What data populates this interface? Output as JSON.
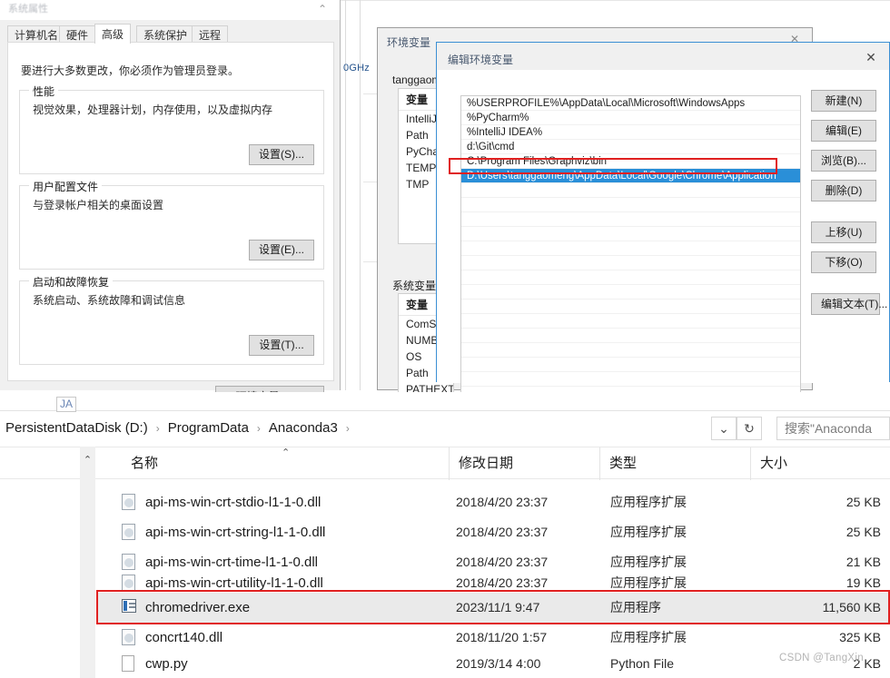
{
  "system_properties": {
    "title": "系统属性",
    "close_icon": "close-icon",
    "tabs": [
      {
        "label": "计算机名",
        "active": false
      },
      {
        "label": "硬件",
        "active": false
      },
      {
        "label": "高级",
        "active": true
      },
      {
        "label": "系统保护",
        "active": false
      },
      {
        "label": "远程",
        "active": false
      }
    ],
    "hint": "要进行大多数更改，你必须作为管理员登录。",
    "groups": [
      {
        "title": "性能",
        "text": "视觉效果，处理器计划，内存使用，以及虚拟内存",
        "button": "设置(S)..."
      },
      {
        "title": "用户配置文件",
        "text": "与登录帐户相关的桌面设置",
        "button": "设置(E)..."
      },
      {
        "title": "启动和故障恢复",
        "text": "系统启动、系统故障和调试信息",
        "button": "设置(T)..."
      }
    ],
    "env_button": "环境变量(N)..."
  },
  "backdrop": {
    "cpu_fragment": "0GHz"
  },
  "env_window": {
    "title": "环境变量",
    "close_icon": "close-icon",
    "user_section_label": "tanggaome",
    "user_list_header": "变量",
    "user_vars": [
      "IntelliJ IDE",
      "Path",
      "PyCharm",
      "TEMP",
      "TMP"
    ],
    "system_section_label": "系统变量(S)",
    "system_list_header": "变量",
    "system_vars": [
      "ComSpec",
      "NUMBER_",
      "OS",
      "Path",
      "PATHEXT"
    ]
  },
  "edit_dialog": {
    "title": "编辑环境变量",
    "close_icon": "close-icon",
    "paths": [
      {
        "value": "%USERPROFILE%\\AppData\\Local\\Microsoft\\WindowsApps",
        "selected": false
      },
      {
        "value": "%PyCharm%",
        "selected": false
      },
      {
        "value": "%IntelliJ IDEA%",
        "selected": false
      },
      {
        "value": "d:\\Git\\cmd",
        "selected": false
      },
      {
        "value": "C:\\Program Files\\Graphviz\\bin",
        "selected": false
      },
      {
        "value": "D:\\Users\\tanggaomeng\\AppData\\Local\\Google\\Chrome\\Application",
        "selected": true
      }
    ],
    "buttons": {
      "new": "新建(N)",
      "edit": "编辑(E)",
      "browse": "浏览(B)...",
      "delete": "删除(D)",
      "move_up": "上移(U)",
      "move_down": "下移(O)",
      "edit_text": "编辑文本(T)..."
    }
  },
  "explorer": {
    "tooltip": "JA",
    "breadcrumb": [
      "PersistentDataDisk (D:)",
      "ProgramData",
      "Anaconda3"
    ],
    "breadcrumb_separator": "›",
    "dropdown_icon": "chevron-down-icon",
    "refresh_icon": "refresh-icon",
    "search_placeholder": "搜索\"Anaconda",
    "columns": [
      {
        "label": "名称",
        "sort": "ascending"
      },
      {
        "label": "修改日期",
        "sort": null
      },
      {
        "label": "类型",
        "sort": null
      },
      {
        "label": "大小",
        "sort": null
      }
    ],
    "scroll_up_icon": "chevron-up-icon",
    "files": [
      {
        "name": "api-ms-win-crt-stdio-l1-1-0.dll",
        "date": "2018/4/20 23:37",
        "type": "应用程序扩展",
        "size": "25 KB",
        "icon": "dll-icon",
        "selected": false
      },
      {
        "name": "api-ms-win-crt-string-l1-1-0.dll",
        "date": "2018/4/20 23:37",
        "type": "应用程序扩展",
        "size": "25 KB",
        "icon": "dll-icon",
        "selected": false
      },
      {
        "name": "api-ms-win-crt-time-l1-1-0.dll",
        "date": "2018/4/20 23:37",
        "type": "应用程序扩展",
        "size": "21 KB",
        "icon": "dll-icon",
        "selected": false
      },
      {
        "name": "api-ms-win-crt-utility-l1-1-0.dll",
        "date": "2018/4/20 23:37",
        "type": "应用程序扩展",
        "size": "19 KB",
        "icon": "dll-icon",
        "selected": false
      },
      {
        "name": "chromedriver.exe",
        "date": "2023/11/1 9:47",
        "type": "应用程序",
        "size": "11,560 KB",
        "icon": "exe-icon",
        "selected": true
      },
      {
        "name": "concrt140.dll",
        "date": "2018/11/20 1:57",
        "type": "应用程序扩展",
        "size": "325 KB",
        "icon": "dll-icon",
        "selected": false
      },
      {
        "name": "cwp.py",
        "date": "2019/3/14 4:00",
        "type": "Python File",
        "size": "2 KB",
        "icon": "py-icon",
        "selected": false
      }
    ],
    "watermark": "CSDN @TangXin"
  },
  "colors": {
    "selection_blue": "#2a8fd8",
    "annotation_red": "#e02020",
    "dialog_border_blue": "#3b8fd4",
    "window_gray": "#f0f0f0"
  }
}
